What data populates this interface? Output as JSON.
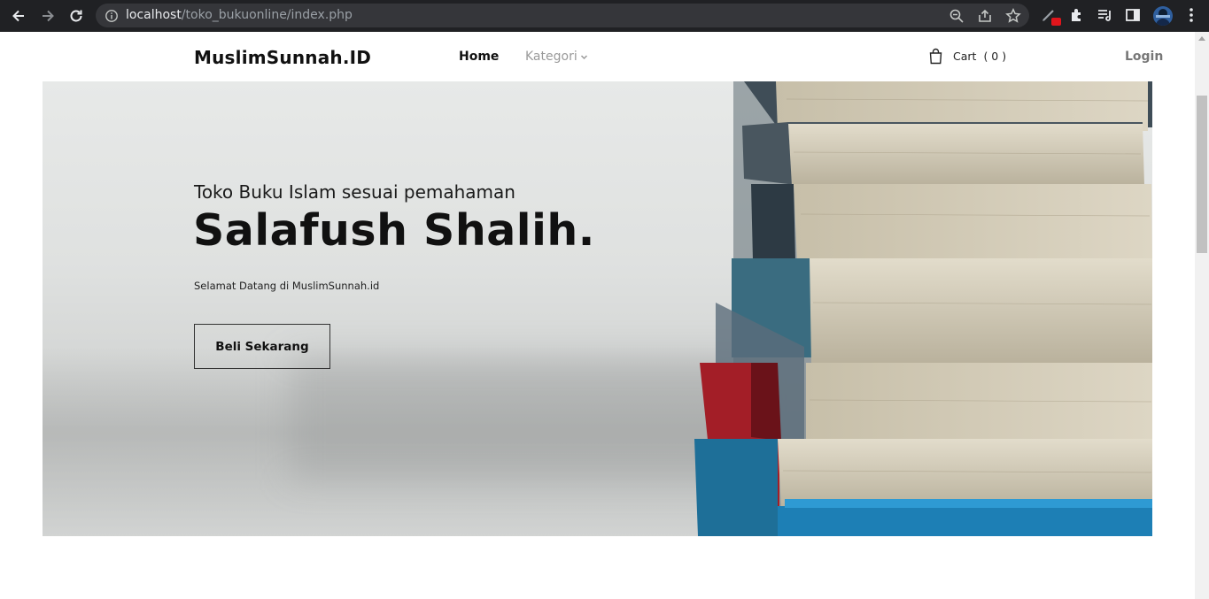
{
  "browser": {
    "url_host": "localhost",
    "url_path": "/toko_bukuonline/index.php",
    "icons": [
      "back-icon",
      "forward-icon",
      "reload-icon",
      "info-icon",
      "zoom-icon",
      "share-icon",
      "star-icon",
      "pen-extension-icon",
      "puzzle-extensions-icon",
      "reading-list-icon",
      "side-panel-icon",
      "profile-avatar",
      "kebab-menu-icon"
    ]
  },
  "header": {
    "logo": "MuslimSunnah.ID",
    "nav": {
      "home": "Home",
      "kategori": "Kategori"
    },
    "cart": {
      "label": "Cart",
      "count": "( 0 )"
    },
    "login": "Login"
  },
  "hero": {
    "subtitle": "Toko Buku Islam sesuai pemahaman",
    "title": "Salafush Shalih.",
    "welcome": "Selamat Datang di MuslimSunnah.id",
    "cta": "Beli Sekarang"
  },
  "colors": {
    "chrome_bg": "#202124",
    "omnibox_bg": "#35363a",
    "text_dark": "#111111",
    "nav_muted": "#9a9a9a",
    "badge_red": "#e0151c"
  }
}
